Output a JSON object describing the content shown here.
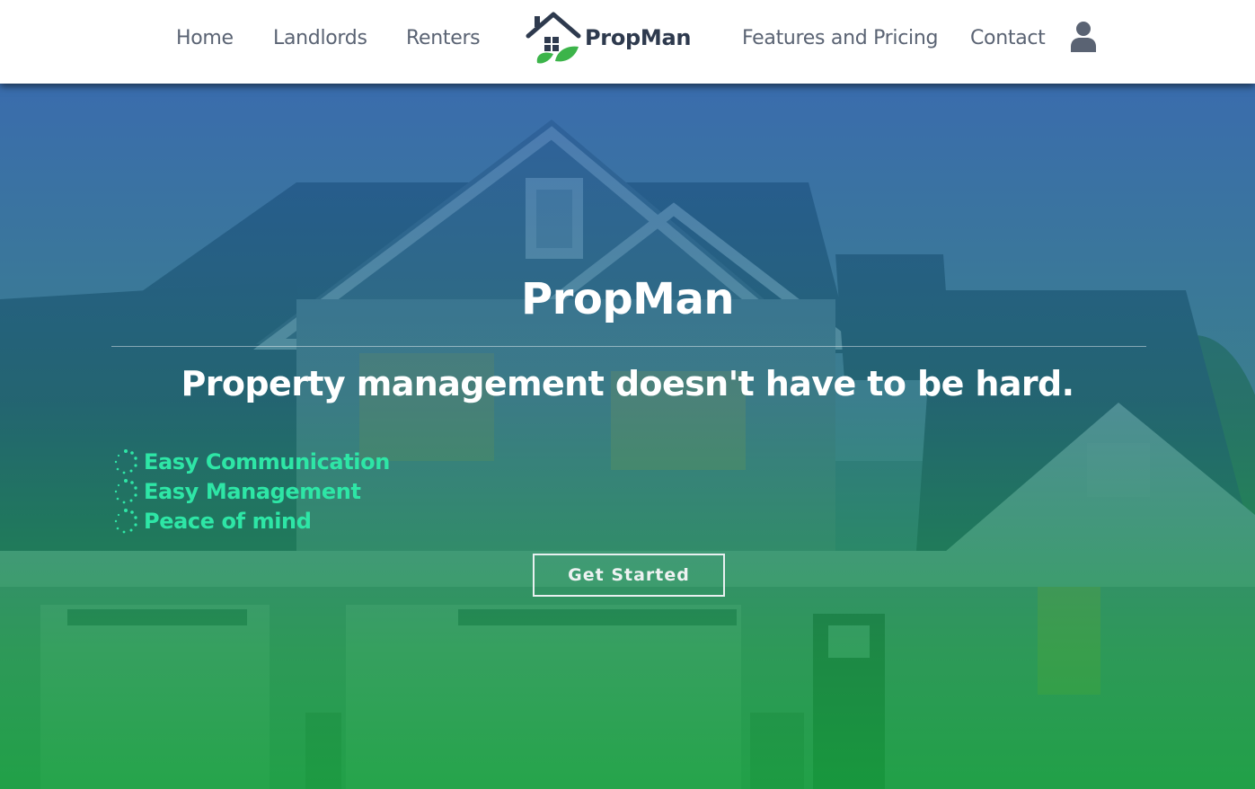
{
  "nav": {
    "links": [
      "Home",
      "Landlords",
      "Renters",
      "Features and Pricing",
      "Contact"
    ],
    "brand": "PropMan",
    "logo_icon": "house-with-leaves-icon",
    "user_icon": "user-account-icon"
  },
  "hero": {
    "title": "PropMan",
    "subtitle": "Property management doesn't have to be hard.",
    "features": [
      "Easy Communication",
      "Easy Management",
      "Peace of mind"
    ],
    "feature_icon": "dotted-spinner-icon",
    "cta_label": "Get Started"
  },
  "colors": {
    "nav_text": "#5a6373",
    "brand_dark": "#2e3a4e",
    "brand_green": "#3cb44a",
    "feature_accent": "#2ee6a6",
    "overlay_top": "#225ca8",
    "overlay_bottom": "#14a03c"
  }
}
